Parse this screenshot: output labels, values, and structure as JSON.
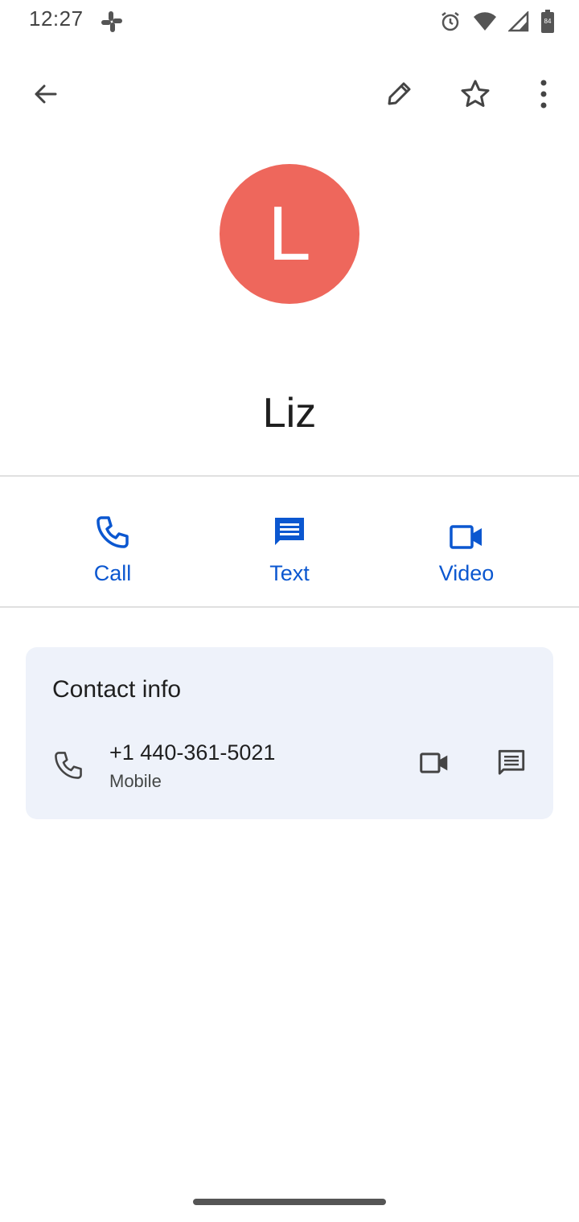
{
  "status_bar": {
    "time": "12:27",
    "notification_icon": "slack-icon",
    "icons": [
      "alarm-icon",
      "wifi-icon",
      "cell-signal-icon",
      "battery-icon"
    ],
    "battery_level": "84"
  },
  "toolbar": {
    "back_icon": "arrow-back-icon",
    "edit_icon": "pencil-icon",
    "favorite_icon": "star-outline-icon",
    "more_icon": "more-vert-icon"
  },
  "contact": {
    "initial": "L",
    "name": "Liz",
    "avatar_color": "#ee675c"
  },
  "actions": [
    {
      "label": "Call",
      "icon": "phone-icon"
    },
    {
      "label": "Text",
      "icon": "message-icon"
    },
    {
      "label": "Video",
      "icon": "videocam-icon"
    }
  ],
  "contact_info": {
    "title": "Contact info",
    "phone": {
      "number": "+1 440-361-5021",
      "type": "Mobile"
    }
  },
  "colors": {
    "accent": "#0b57d0",
    "card_bg": "#eef2fa"
  }
}
